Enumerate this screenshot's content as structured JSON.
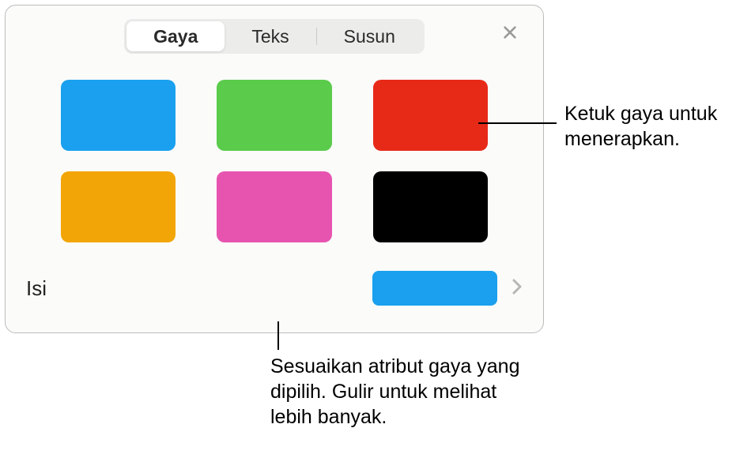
{
  "tabs": {
    "style": "Gaya",
    "text": "Teks",
    "arrange": "Susun"
  },
  "styles": {
    "swatches": [
      {
        "color": "#1aa0ee"
      },
      {
        "color": "#5acb4b"
      },
      {
        "color": "#e72a18"
      },
      {
        "color": "#f2a506"
      },
      {
        "color": "#e754b0"
      },
      {
        "color": "#000000"
      }
    ]
  },
  "fill": {
    "label": "Isi",
    "color": "#1aa0ee"
  },
  "callouts": {
    "top": "Ketuk gaya untuk menerapkan.",
    "bottom": "Sesuaikan atribut gaya yang dipilih. Gulir untuk melihat lebih banyak."
  }
}
